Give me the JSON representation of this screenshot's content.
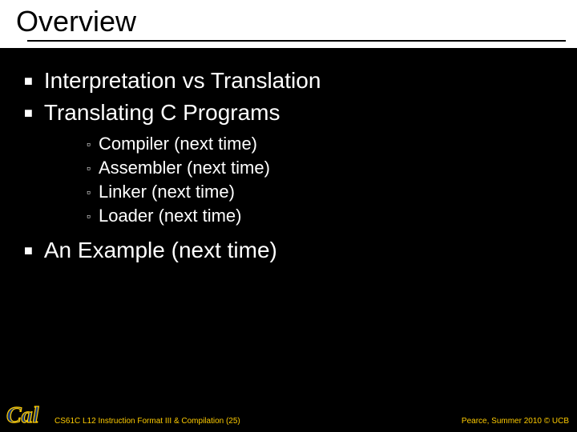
{
  "title": "Overview",
  "bullets": [
    {
      "text": "Interpretation vs Translation"
    },
    {
      "text": "Translating C Programs",
      "children": [
        "Compiler (next time)",
        "Assembler (next time)",
        "Linker (next time)",
        "Loader (next time)"
      ]
    },
    {
      "text": "An Example (next time)"
    }
  ],
  "footer": {
    "left": "CS61C L12 Instruction Format III & Compilation (25)",
    "right": "Pearce, Summer 2010 © UCB"
  },
  "logo_alt": "Cal"
}
